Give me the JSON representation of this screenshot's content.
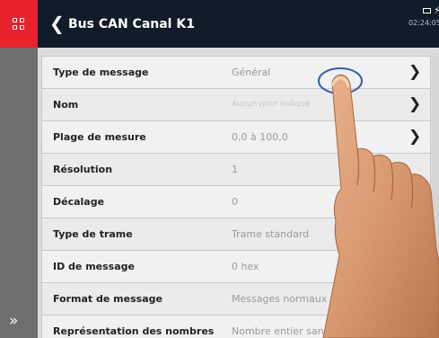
{
  "header": {
    "title": "Bus CAN Canal K1",
    "time": "02:24:05"
  },
  "icons": {
    "menu": "grid-icon",
    "back": "chevron-left-icon",
    "battery": "battery-icon",
    "power": "lightning-icon",
    "expand": "double-chevron-right-icon",
    "row_arrow": "chevron-right-icon"
  },
  "colors": {
    "menu_button": "#e8232b",
    "topbar": "#101c29",
    "rail": "#6e6e6e"
  },
  "rows": [
    {
      "label": "Type de message",
      "value": "Général",
      "has_arrow": true
    },
    {
      "label": "Nom",
      "value": "Aucun nom indiqué",
      "has_arrow": true
    },
    {
      "label": "Plage de mesure",
      "value": "0,0 à 100,0",
      "has_arrow": true
    },
    {
      "label": "Résolution",
      "value": "1",
      "has_arrow": false
    },
    {
      "label": "Décalage",
      "value": "0",
      "has_arrow": false
    },
    {
      "label": "Type de trame",
      "value": "Trame standard",
      "has_arrow": false
    },
    {
      "label": "ID de message",
      "value": "0 hex",
      "has_arrow": true
    },
    {
      "label": "Format de message",
      "value": "Messages normaux",
      "has_arrow": true
    },
    {
      "label": "Représentation des nombres",
      "value": "Nombre entier sans signe",
      "has_arrow": true
    }
  ]
}
